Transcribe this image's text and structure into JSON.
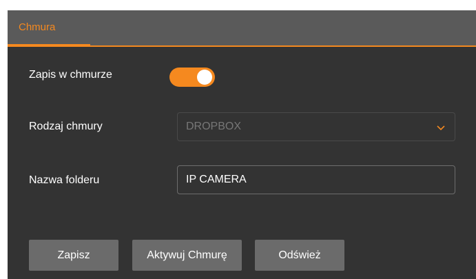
{
  "tabs": [
    {
      "label": "Chmura",
      "active": true
    }
  ],
  "form": {
    "cloud_recording": {
      "label": "Zapis w chmurze",
      "enabled": true
    },
    "cloud_type": {
      "label": "Rodzaj chmury",
      "value": "DROPBOX"
    },
    "folder_name": {
      "label": "Nazwa folderu",
      "value": "IP CAMERA"
    }
  },
  "buttons": {
    "save": "Zapisz",
    "activate": "Aktywuj Chmurę",
    "refresh": "Odśwież"
  },
  "colors": {
    "accent": "#f5891f",
    "panel_bg": "#333333",
    "tabbar_bg": "#5a5a5a",
    "button_bg": "#6b6b6b"
  }
}
